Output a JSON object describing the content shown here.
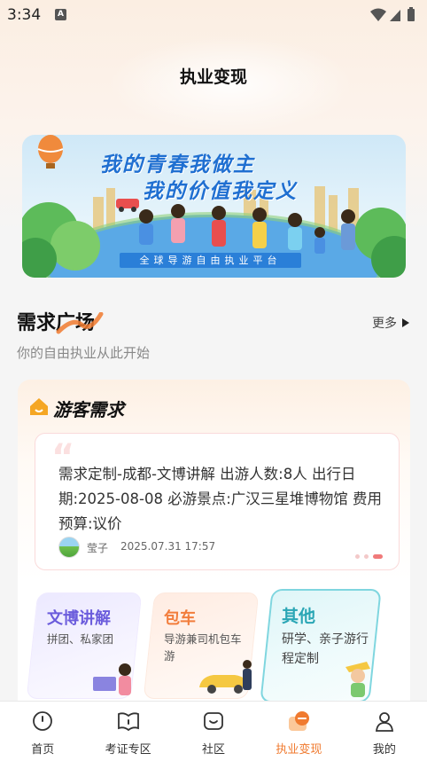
{
  "status_bar": {
    "time": "3:34",
    "notification_badge": "A"
  },
  "header": {
    "title": "执业变现"
  },
  "banner": {
    "headline_1": "我的青春我做主",
    "headline_2": "我的价值我定义",
    "ribbon": "全球导游自由执业平台"
  },
  "section": {
    "title": "需求广场",
    "more_label": "更多",
    "subtitle": "你的自由执业从此开始"
  },
  "demand_card": {
    "title": "游客需求",
    "post": {
      "text": "需求定制-成都-文博讲解 出游人数:8人 出行日期:2025-08-08 必游景点:广汉三星堆博物馆 费用预算:议价",
      "user": "莹子",
      "time": "2025.07.31 17:57"
    },
    "carousel_active_index": 2,
    "categories": [
      {
        "title": "文博讲解",
        "desc": "拼团、私家团"
      },
      {
        "title": "包车",
        "desc": "导游兼司机包车游"
      },
      {
        "title": "其他",
        "desc": "研学、亲子游行程定制"
      }
    ]
  },
  "tab_bar": {
    "items": [
      {
        "label": "首页",
        "icon": "home-icon"
      },
      {
        "label": "考证专区",
        "icon": "book-icon"
      },
      {
        "label": "社区",
        "icon": "community-icon"
      },
      {
        "label": "执业变现",
        "icon": "monetize-icon"
      },
      {
        "label": "我的",
        "icon": "profile-icon"
      }
    ],
    "active_index": 3
  },
  "colors": {
    "accent": "#f07a2f",
    "banner_text": "#1f6fd1",
    "carousel_active": "#f07a7a"
  }
}
